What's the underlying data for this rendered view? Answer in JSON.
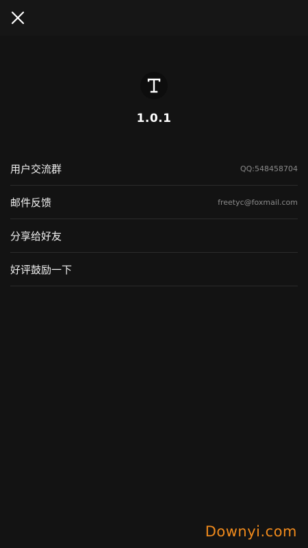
{
  "header": {
    "close_icon": "close-icon"
  },
  "app": {
    "logo_icon": "letter-t-logo",
    "version": "1.0.1"
  },
  "menu": {
    "items": [
      {
        "label": "用户交流群",
        "value": "QQ:548458704"
      },
      {
        "label": "邮件反馈",
        "value": "freetyc@foxmail.com"
      },
      {
        "label": "分享给好友",
        "value": ""
      },
      {
        "label": "好评鼓励一下",
        "value": ""
      }
    ]
  },
  "watermark": "Downyi.com",
  "colors": {
    "background": "#131313",
    "divider": "#2c2c2c",
    "watermark": "#f08a1c"
  }
}
